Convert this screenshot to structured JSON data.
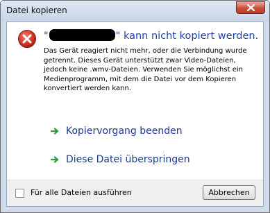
{
  "window": {
    "title": "Datei kopieren",
    "close_icon": "close-icon"
  },
  "dialog": {
    "icon": "error-icon",
    "heading_open_quote": "\"",
    "heading_redacted": "",
    "heading_rest": "\" kann nicht kopiert werden.",
    "message": "Das Gerät reagiert nicht mehr, oder die Verbindung wurde getrennt. Dieses Gerät unterstützt zwar Video-Dateien, jedoch keine .wmv-Dateien. Verwenden Sie möglichst ein Medienprogramm, mit dem die Datei vor dem Kopieren konvertiert werden kann.",
    "commands": [
      {
        "label": "Kopiervorgang beenden",
        "icon": "green-arrow-icon"
      },
      {
        "label": "Diese Datei überspringen",
        "icon": "green-arrow-icon"
      }
    ]
  },
  "footer": {
    "checkbox_label": "Für alle Dateien ausführen",
    "checkbox_checked": false,
    "cancel_label": "Abbrechen"
  },
  "colors": {
    "heading": "#1f3fa8",
    "command_text": "#1a3a96",
    "arrow": "#2e9e3a",
    "error_red": "#c8281e"
  }
}
